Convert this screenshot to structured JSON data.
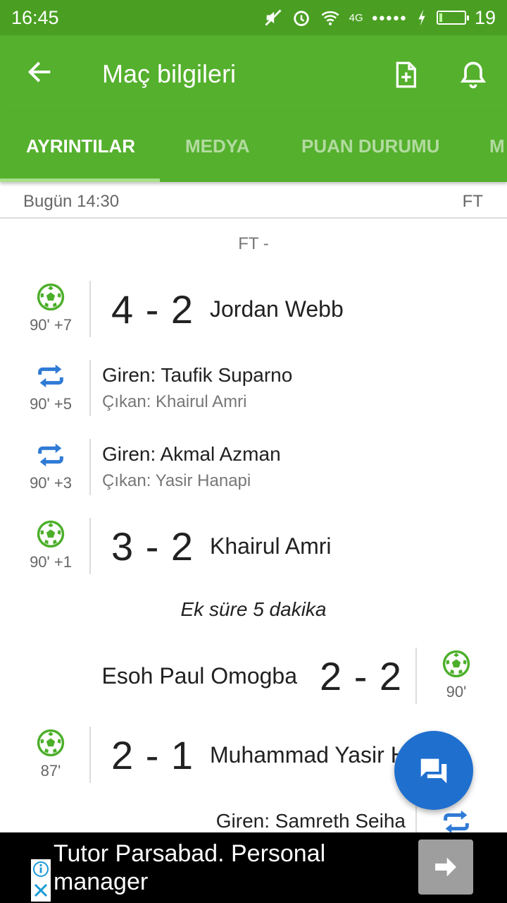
{
  "status_bar": {
    "time": "16:45",
    "network": "4G",
    "signal_dots": "●●●●●",
    "battery_level": "19"
  },
  "app_bar": {
    "title": "Maç bilgileri",
    "back_icon": "arrow-back-icon",
    "add_doc_icon": "add-document-icon",
    "notify_icon": "bell-icon"
  },
  "tabs": [
    {
      "label": "AYRINTILAR",
      "active": true
    },
    {
      "label": "MEDYA",
      "active": false
    },
    {
      "label": "PUAN DURUMU",
      "active": false
    },
    {
      "label": "M",
      "active": false
    }
  ],
  "match": {
    "date": "Bugün 14:30",
    "status": "FT",
    "ft_line": "FT  -"
  },
  "events": [
    {
      "type": "goal",
      "minute": "90' +7",
      "score": "4 - 2",
      "player": "Jordan Webb"
    },
    {
      "type": "sub",
      "minute": "90' +5",
      "in": "Giren: Taufik Suparno",
      "out": "Çıkan: Khairul Amri"
    },
    {
      "type": "sub",
      "minute": "90' +3",
      "in": "Giren: Akmal Azman",
      "out": "Çıkan: Yasir Hanapi"
    },
    {
      "type": "goal",
      "minute": "90' +1",
      "score": "3 - 2",
      "player": "Khairul Amri"
    },
    {
      "type": "goal_away",
      "minute": "90'",
      "score": "2 - 2",
      "player": "Esoh Paul Omogba"
    },
    {
      "type": "goal",
      "minute": "87'",
      "score": "2 - 1",
      "player": "Muhammad Yasir Hanapi"
    },
    {
      "type": "sub_away",
      "in": "Giren: Samreth Seiha"
    }
  ],
  "extra_time": "Ek süre 5 dakika",
  "ad": {
    "text": "Tutor Parsabad. Personal manager"
  },
  "colors": {
    "primary": "#55b02d",
    "status_bar": "#4a9f22",
    "fab": "#1f6fcf",
    "goal_icon": "#4caf2a",
    "sub_icon": "#2f7bd6"
  }
}
